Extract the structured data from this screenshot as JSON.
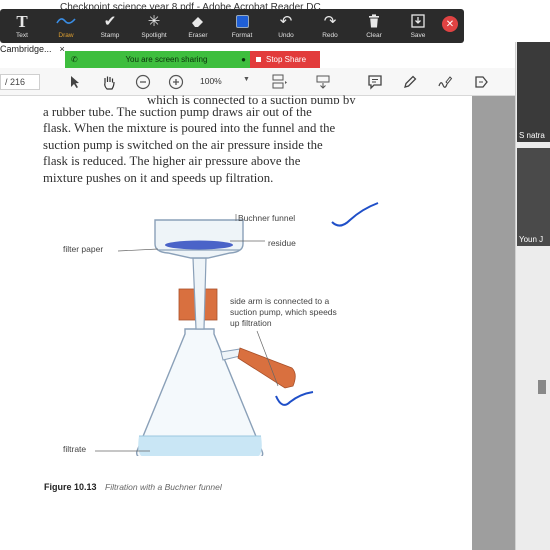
{
  "window": {
    "title": "Checkpoint science year 8.pdf - Adobe Acrobat Reader DC",
    "tab_label": "Cambridge...",
    "tab_close": "×"
  },
  "annotation_toolbar": {
    "items": [
      {
        "label": "Text",
        "icon": "T"
      },
      {
        "label": "Draw",
        "icon": "〜",
        "active": true
      },
      {
        "label": "Stamp",
        "icon": "✔"
      },
      {
        "label": "Spotlight",
        "icon": "✳"
      },
      {
        "label": "Eraser",
        "icon": "⌫"
      },
      {
        "label": "Format",
        "icon": "■"
      },
      {
        "label": "Undo",
        "icon": "↶"
      },
      {
        "label": "Redo",
        "icon": "↷"
      },
      {
        "label": "Clear",
        "icon": "🗑"
      },
      {
        "label": "Save",
        "icon": "⤓"
      }
    ],
    "close_icon": "✕",
    "active_color": "#e0a030",
    "format_color": "#1f5fd6"
  },
  "share_banner": {
    "status_text": "You are screen sharing",
    "stop_label": "Stop Share",
    "green": "#3ebe3e",
    "red": "#e23b3b"
  },
  "acrobat_toolbar": {
    "page_total": "/ 216",
    "zoom": "100%"
  },
  "document": {
    "partial_first_line": "which is connected to a suction pump by",
    "paragraph": "a rubber tube. The suction pump draws air out of the flask. When the mixture is poured into the funnel and the suction pump is switched on the air pressure inside the flask is reduced. The higher air pressure above the mixture pushes on it and speeds up filtration.",
    "lines": [
      "a rubber tube. The suction pump draws air out of the",
      "flask. When the mixture is poured into the funnel and the",
      "suction pump is switched on the air pressure inside the",
      "flask is reduced. The higher air pressure above the",
      "mixture pushes on it and speeds up filtration."
    ],
    "figure": {
      "labels": {
        "buchner_funnel": "Buchner funnel",
        "residue": "residue",
        "filter_paper": "filter paper",
        "side_arm_1": "side arm is connected to a",
        "side_arm_2": "suction pump, which speeds",
        "side_arm_3": "up filtration",
        "filtrate": "filtrate"
      },
      "caption_number": "Figure 10.13",
      "caption_text": "Filtration with a Buchner funnel"
    }
  },
  "participants": [
    {
      "name": "S natra"
    },
    {
      "name": "Youn J"
    }
  ]
}
